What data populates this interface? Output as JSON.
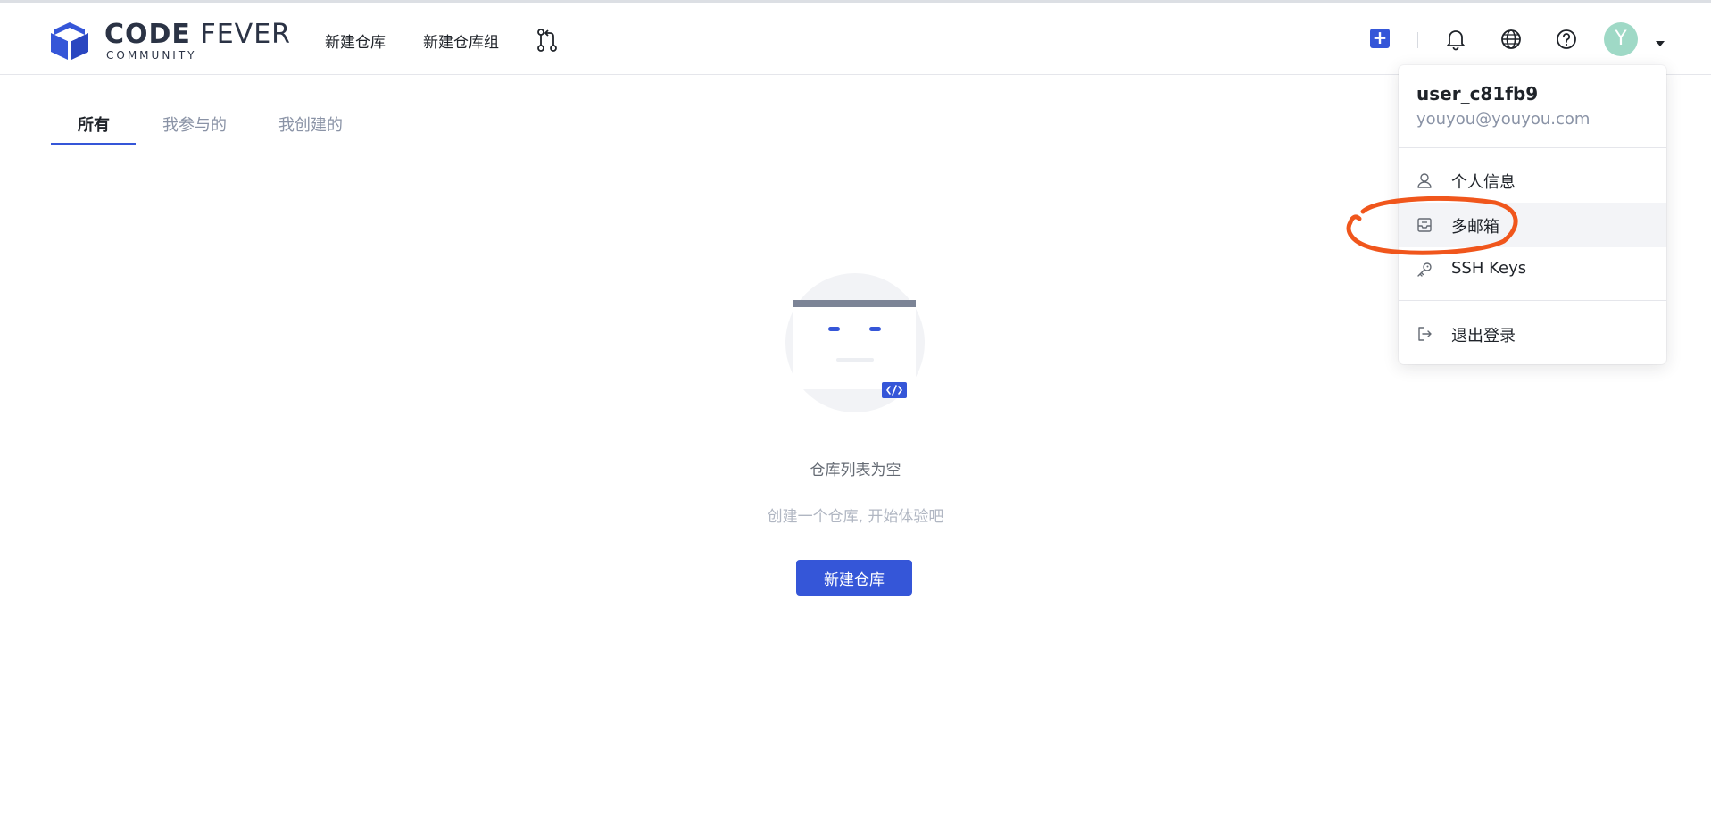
{
  "header": {
    "logo": {
      "main_bold": "CODE",
      "main_light": " FEVER",
      "sub": "COMMUNITY"
    },
    "nav": {
      "new_repo": "新建仓库",
      "new_repo_group": "新建仓库组"
    },
    "icons": {
      "merge_request": "merge-request-icon",
      "plus": "plus-icon",
      "bell": "bell-icon",
      "globe": "globe-icon",
      "help": "help-icon"
    },
    "plus_symbol": "+",
    "avatar_letter": "Y"
  },
  "tabs": [
    {
      "label": "所有",
      "active": true
    },
    {
      "label": "我参与的",
      "active": false
    },
    {
      "label": "我创建的",
      "active": false
    }
  ],
  "empty_state": {
    "title": "仓库列表为空",
    "subtitle": "创建一个仓库, 开始体验吧",
    "button": "新建仓库"
  },
  "user_menu": {
    "username": "user_c81fb9",
    "email": "youyou@youyou.com",
    "items": [
      {
        "label": "个人信息",
        "icon": "user-icon"
      },
      {
        "label": "多邮箱",
        "icon": "inbox-icon"
      },
      {
        "label": "SSH Keys",
        "icon": "key-icon"
      },
      {
        "label": "退出登录",
        "icon": "logout-icon"
      }
    ]
  },
  "colors": {
    "primary": "#3556d8",
    "avatar_bg": "#9fd9c6",
    "annotation": "#f0561c"
  }
}
